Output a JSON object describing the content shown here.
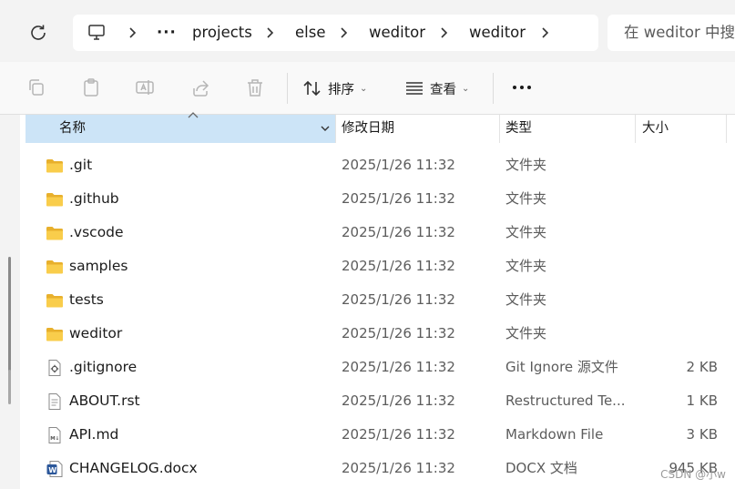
{
  "address": {
    "items": [
      "projects",
      "else",
      "weditor",
      "weditor"
    ],
    "overflow_label": "···",
    "search_placeholder": "在 weditor 中搜索"
  },
  "toolbar": {
    "sort_label": "排序",
    "view_label": "查看",
    "more_label": "···"
  },
  "columns": {
    "name": "名称",
    "modified": "修改日期",
    "type": "类型",
    "size": "大小"
  },
  "files": [
    {
      "name": ".git",
      "modified": "2025/1/26 11:32",
      "type": "文件夹",
      "size": "",
      "icon": "folder-icon"
    },
    {
      "name": ".github",
      "modified": "2025/1/26 11:32",
      "type": "文件夹",
      "size": "",
      "icon": "folder-icon"
    },
    {
      "name": ".vscode",
      "modified": "2025/1/26 11:32",
      "type": "文件夹",
      "size": "",
      "icon": "folder-icon"
    },
    {
      "name": "samples",
      "modified": "2025/1/26 11:32",
      "type": "文件夹",
      "size": "",
      "icon": "folder-icon"
    },
    {
      "name": "tests",
      "modified": "2025/1/26 11:32",
      "type": "文件夹",
      "size": "",
      "icon": "folder-icon"
    },
    {
      "name": "weditor",
      "modified": "2025/1/26 11:32",
      "type": "文件夹",
      "size": "",
      "icon": "folder-icon"
    },
    {
      "name": ".gitignore",
      "modified": "2025/1/26 11:32",
      "type": "Git Ignore 源文件",
      "size": "2 KB",
      "icon": "config-file-icon"
    },
    {
      "name": "ABOUT.rst",
      "modified": "2025/1/26 11:32",
      "type": "Restructured Te...",
      "size": "1 KB",
      "icon": "text-file-icon"
    },
    {
      "name": "API.md",
      "modified": "2025/1/26 11:32",
      "type": "Markdown File",
      "size": "3 KB",
      "icon": "markdown-file-icon"
    },
    {
      "name": "CHANGELOG.docx",
      "modified": "2025/1/26 11:32",
      "type": "DOCX 文档",
      "size": "945 KB",
      "icon": "word-file-icon"
    }
  ],
  "watermark": "CSDN @小w",
  "colors": {
    "selected_header": "#cce4f7",
    "folder": "#f7c948",
    "word": "#2b579a"
  }
}
